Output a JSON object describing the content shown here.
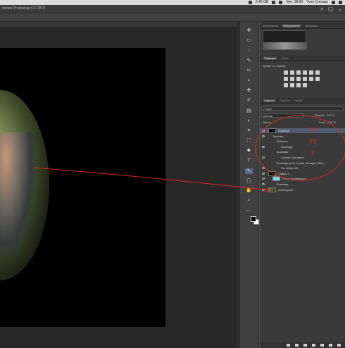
{
  "menubar": {
    "battery": "2,49 GB",
    "date": "Ven. 18:09",
    "user": "Yves Creusaz"
  },
  "app": {
    "title": "Adobe Photoshop CC 2019"
  },
  "panels": {
    "top_tabs": [
      "Informations",
      "Histogramme",
      "Navigation"
    ],
    "adjust_tabs": [
      "Réglages",
      "Styles"
    ],
    "adjust_hint": "Ajouter un réglage",
    "layer_tabs": [
      "Calques",
      "Couches",
      "Tracés"
    ],
    "search_kind": "Type",
    "blend_mode": "Normal",
    "opacity_label": "Opacité :",
    "opacity_value": "100 %",
    "lock_label": "Verrou :",
    "fill_label": "Fond :",
    "fill_value": "100 %"
  },
  "layers": [
    {
      "name": "Écaelage",
      "indent": 0,
      "thumb": "black",
      "selected": true,
      "eye": true
    },
    {
      "name": "Textures",
      "indent": 1,
      "eye": true
    },
    {
      "name": "Diffusion",
      "indent": 2
    },
    {
      "name": "Écaelage",
      "indent": 3,
      "eye": true
    },
    {
      "name": "Bouclage",
      "indent": 2
    },
    {
      "name": "Current Document",
      "indent": 3,
      "eye": true
    },
    {
      "name": "Écaelage (rédi à partir d'images DEL)",
      "indent": 2
    },
    {
      "name": "Par défaut ISL",
      "indent": 3,
      "eye": true
    },
    {
      "name": "Calque 1",
      "indent": 0,
      "thumb": "black",
      "eye": true
    },
    {
      "name": "Filtres dynamiques",
      "indent": 1,
      "thumb": "cyan",
      "eye": true
    },
    {
      "name": "Écaelage",
      "indent": 2,
      "eye": true
    },
    {
      "name": "Arrière-plan",
      "indent": 0,
      "thumb": "photo",
      "eye": true
    }
  ],
  "annotations": {
    "q1": "??",
    "q2": "??",
    "q3": "?"
  },
  "colors": {
    "annotation": "#d62c24",
    "selected_layer": "#4f5b6e"
  }
}
